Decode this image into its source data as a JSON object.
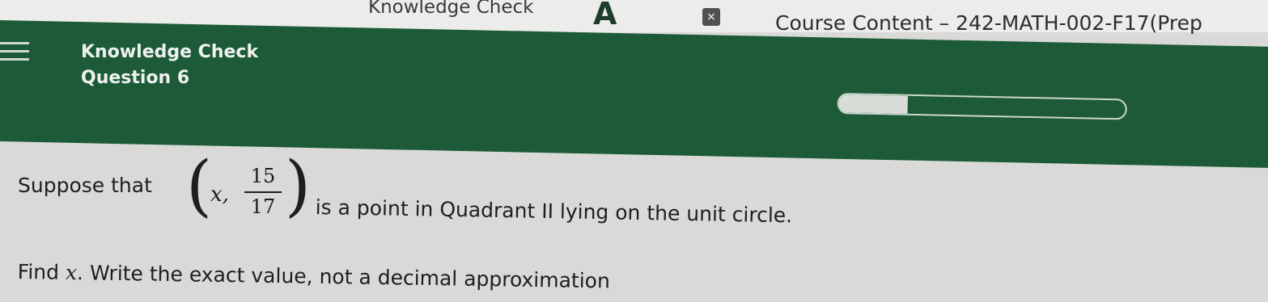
{
  "browser": {
    "tab_title": "Knowledge Check",
    "tab_logo": "A",
    "tab_close": "×",
    "course_title": "Course Content – 242-MATH-002-F17(Prep"
  },
  "header": {
    "title": "Knowledge Check",
    "question": "Question 6",
    "progress": 0.24,
    "menu_icon": "hamburger-menu-icon",
    "colors": {
      "header_green": "#1d5a37",
      "page_bg": "#d9dad7"
    }
  },
  "question": {
    "lead": "Suppose that",
    "point_var": "x",
    "point_sep": ",",
    "numerator": "15",
    "denominator": "17",
    "rest": "is a point in Quadrant II lying on the unit circle.",
    "instruction_find": "Find",
    "instruction_var": "x",
    "instruction_rest": ". Write the exact value, not a decimal approximation"
  }
}
